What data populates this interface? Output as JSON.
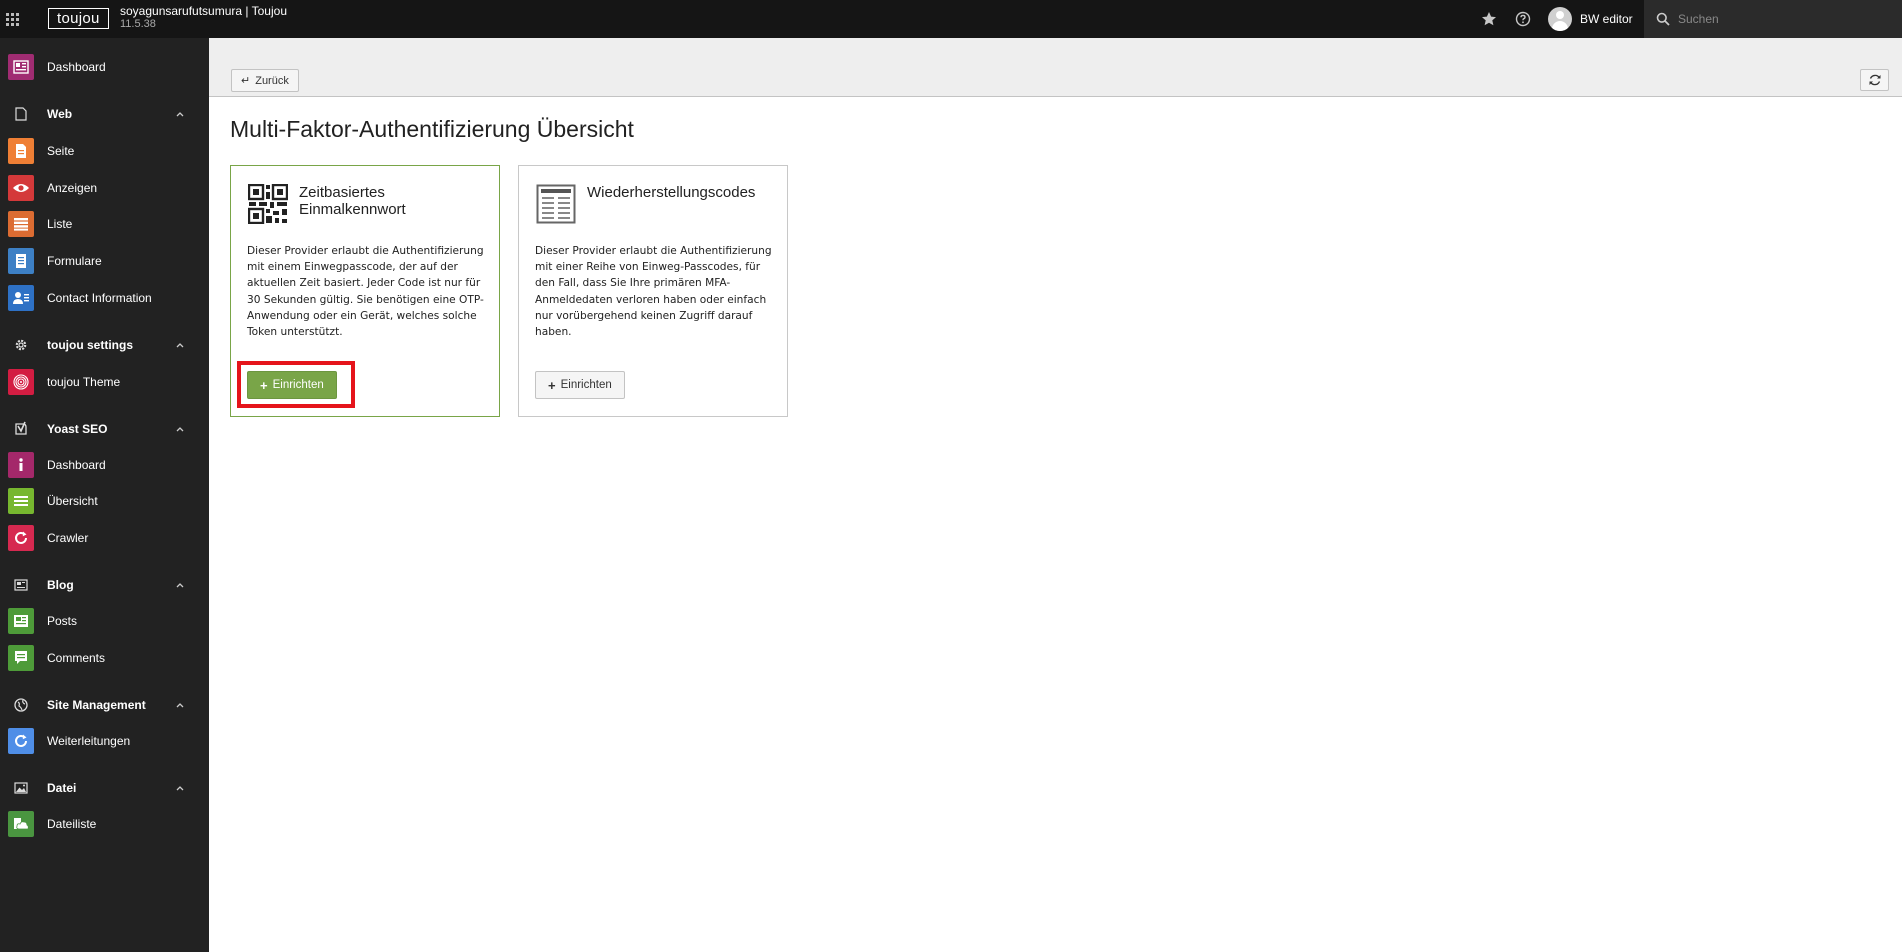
{
  "topbar": {
    "logo": "toujou",
    "site_name": "soyagunsarufutsumura | Toujou",
    "version": "11.5.38",
    "user_name": "BW editor",
    "search_placeholder": "Suchen"
  },
  "sidebar": {
    "dashboard": "Dashboard",
    "web": {
      "label": "Web",
      "items": [
        "Seite",
        "Anzeigen",
        "Liste",
        "Formulare",
        "Contact Information"
      ]
    },
    "settings": {
      "label": "toujou settings",
      "items": [
        "toujou Theme"
      ]
    },
    "yoast": {
      "label": "Yoast SEO",
      "items": [
        "Dashboard",
        "Übersicht",
        "Crawler"
      ]
    },
    "blog": {
      "label": "Blog",
      "items": [
        "Posts",
        "Comments"
      ]
    },
    "site": {
      "label": "Site Management",
      "items": [
        "Weiterleitungen"
      ]
    },
    "datei": {
      "label": "Datei",
      "items": [
        "Dateiliste"
      ]
    }
  },
  "colors": {
    "dashboard": "#a02c72",
    "seite": "#ef7f35",
    "anzeigen": "#d4393a",
    "liste": "#dc6c32",
    "formulare": "#3d80c5",
    "contact": "#2e71c5",
    "theme": "#d31d42",
    "yoast_dashboard": "#a4286a",
    "yoast_uebersicht": "#77b72f",
    "crawler": "#d62950",
    "posts": "#4e9b39",
    "comments": "#4e9b39",
    "weiterleitungen": "#4f8ee7",
    "dateiliste": "#4a9540",
    "accent_green": "#79a548",
    "highlight_red": "#e5141b"
  },
  "header": {
    "back_label": "Zurück"
  },
  "main": {
    "title": "Multi-Faktor-Authentifizierung Übersicht",
    "cards": [
      {
        "title": "Zeitbasiertes Einmalkennwort",
        "icon": "qr-code-icon",
        "description": "Dieser Provider erlaubt die Authentifizierung mit einem Einwegpasscode, der auf der aktuellen Zeit basiert. Jeder Code ist nur für 30 Sekunden gültig. Sie benötigen eine OTP-Anwendung oder ein Gerät, welches solche Token unterstützt.",
        "button": "Einrichten"
      },
      {
        "title": "Wiederherstellungscodes",
        "icon": "recovery-codes-icon",
        "description": "Dieser Provider erlaubt die Authentifizierung mit einer Reihe von Einweg-Passcodes, für den Fall, dass Sie Ihre primären MFA-Anmeldedaten verloren haben oder einfach nur vorübergehend keinen Zugriff darauf haben.",
        "button": "Einrichten"
      }
    ]
  }
}
